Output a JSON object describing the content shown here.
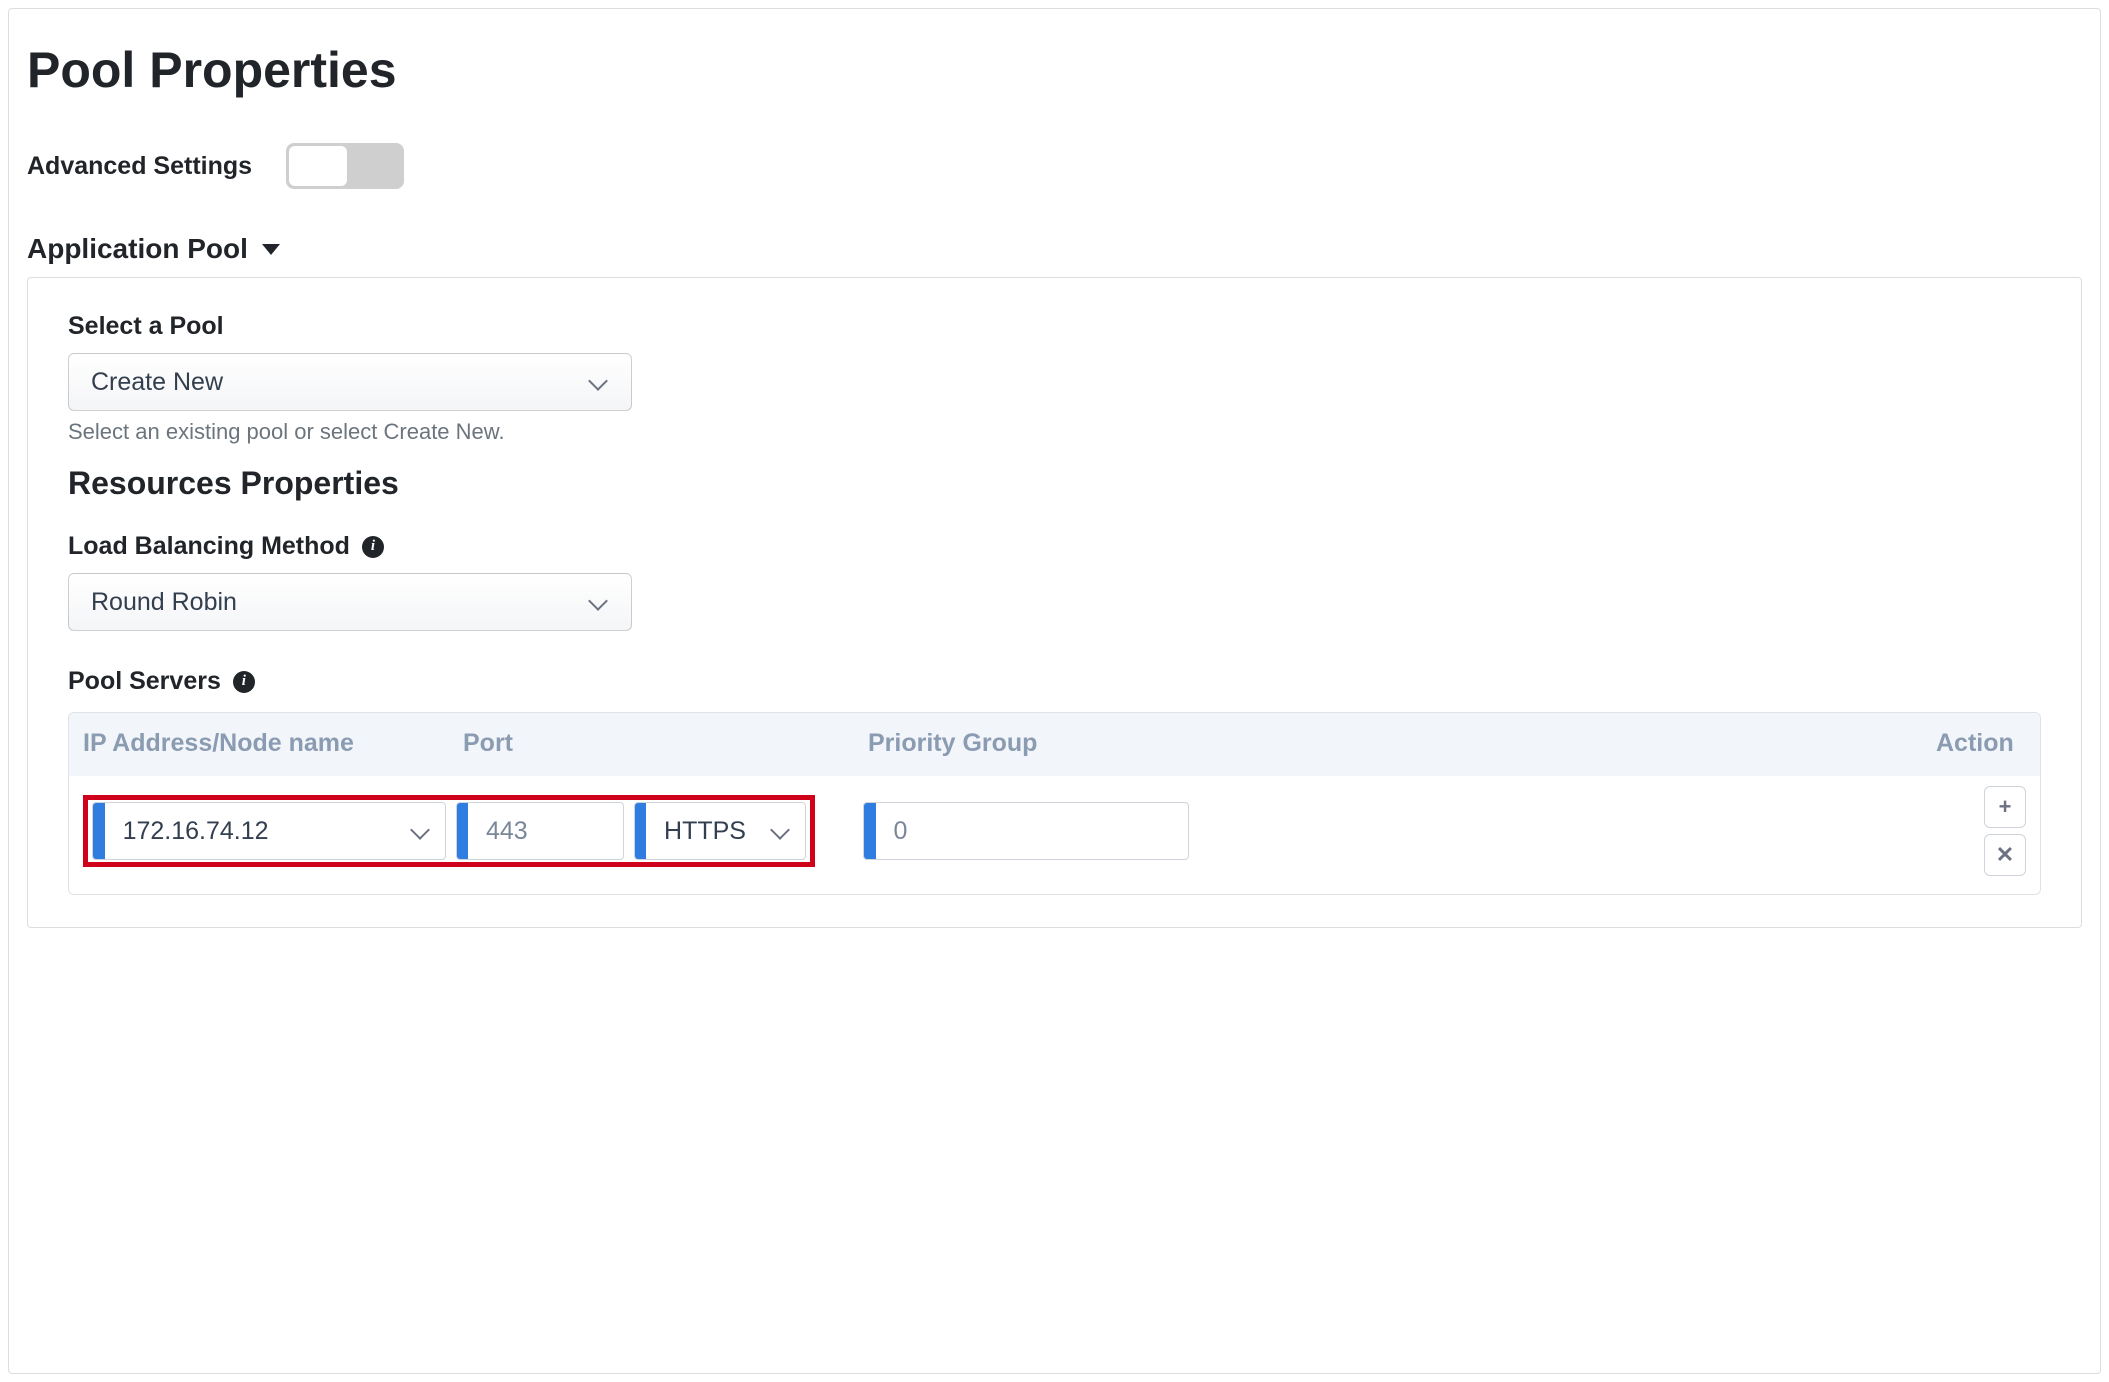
{
  "title": "Pool Properties",
  "advanced_label": "Advanced Settings",
  "advanced_on": false,
  "section": {
    "heading": "Application Pool",
    "select_pool": {
      "label": "Select a Pool",
      "value": "Create New",
      "help": "Select an existing pool or select Create New."
    },
    "resources_heading": "Resources Properties",
    "lb_method": {
      "label": "Load Balancing Method",
      "value": "Round Robin"
    },
    "pool_servers": {
      "label": "Pool Servers",
      "headers": {
        "ip": "IP Address/Node name",
        "port": "Port",
        "priority": "Priority Group",
        "action": "Action"
      },
      "rows": [
        {
          "ip": "172.16.74.12",
          "port": "443",
          "protocol": "HTTPS",
          "priority": "0"
        }
      ]
    }
  },
  "glyphs": {
    "info": "i",
    "plus": "+",
    "close": "✕"
  }
}
